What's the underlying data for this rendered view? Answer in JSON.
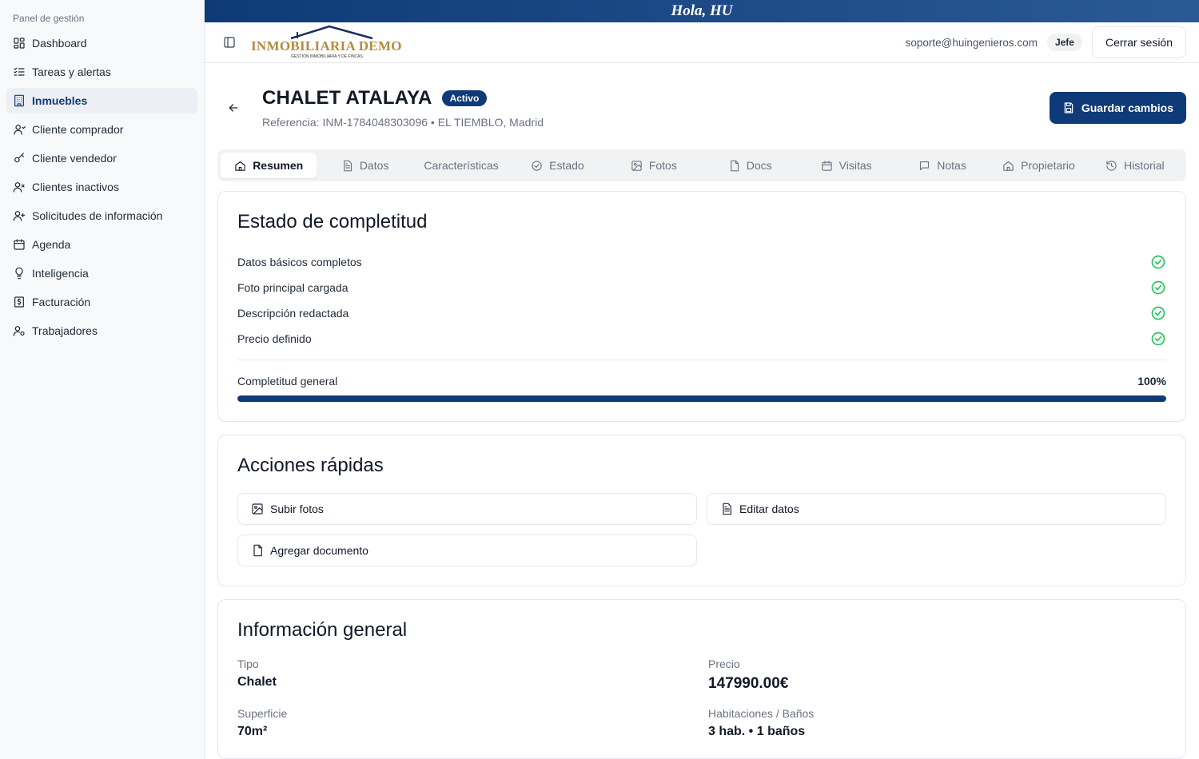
{
  "greeting": "Hola, HU",
  "sidebar": {
    "heading": "Panel de gestión",
    "items": [
      {
        "label": "Dashboard",
        "icon": "layout-grid-icon"
      },
      {
        "label": "Tareas y alertas",
        "icon": "list-checks-icon"
      },
      {
        "label": "Inmuebles",
        "icon": "building-icon",
        "active": true
      },
      {
        "label": "Cliente comprador",
        "icon": "user-icon"
      },
      {
        "label": "Cliente vendedor",
        "icon": "key-icon"
      },
      {
        "label": "Clientes inactivos",
        "icon": "user-x-icon"
      },
      {
        "label": "Solicitudes de información",
        "icon": "user-plus-icon"
      },
      {
        "label": "Agenda",
        "icon": "calendar-icon"
      },
      {
        "label": "Inteligencia",
        "icon": "lightbulb-icon"
      },
      {
        "label": "Facturación",
        "icon": "receipt-icon"
      },
      {
        "label": "Trabajadores",
        "icon": "user-cog-icon"
      }
    ]
  },
  "topbar": {
    "logo_main": "INMOBILIARIA DEMO",
    "logo_sub": "GESTIÓN INMOBILIARIA Y DE FINCAS",
    "email": "soporte@huingenieros.com",
    "role": "Jefe",
    "logout_label": "Cerrar sesión"
  },
  "property": {
    "title": "CHALET ATALAYA",
    "status": "Activo",
    "reference": "Referencia: INM-1784048303096 • EL TIEMBLO, Madrid",
    "save_label": "Guardar cambios"
  },
  "tabs": [
    {
      "label": "Resumen",
      "icon": "home-icon",
      "active": true
    },
    {
      "label": "Datos",
      "icon": "file-text-icon"
    },
    {
      "label": "Características",
      "icon": ""
    },
    {
      "label": "Estado",
      "icon": "check-circle-icon"
    },
    {
      "label": "Fotos",
      "icon": "image-icon"
    },
    {
      "label": "Docs",
      "icon": "file-icon"
    },
    {
      "label": "Visitas",
      "icon": "calendar-icon"
    },
    {
      "label": "Notas",
      "icon": "message-square-icon"
    },
    {
      "label": "Propietario",
      "icon": "home-icon"
    },
    {
      "label": "Historial",
      "icon": "history-icon"
    }
  ],
  "completeness": {
    "title": "Estado de completitud",
    "items": [
      {
        "label": "Datos básicos completos",
        "done": true
      },
      {
        "label": "Foto principal cargada",
        "done": true
      },
      {
        "label": "Descripción redactada",
        "done": true
      },
      {
        "label": "Precio definido",
        "done": true
      }
    ],
    "overall_label": "Completitud general",
    "overall_value": "100%",
    "overall_fraction": 1.0
  },
  "quick_actions": {
    "title": "Acciones rápidas",
    "upload_photos": "Subir fotos",
    "edit_data": "Editar datos",
    "add_document": "Agregar documento"
  },
  "general_info": {
    "title": "Información general",
    "type_label": "Tipo",
    "type_value": "Chalet",
    "price_label": "Precio",
    "price_value": "147990.00€",
    "area_label": "Superficie",
    "area_value": "70m²",
    "rooms_label": "Habitaciones / Baños",
    "rooms_value": "3 hab. • 1 baños"
  },
  "colors": {
    "brand_primary": "#0f3a78",
    "logo_gold": "#b68a3c",
    "success": "#22c55e"
  }
}
